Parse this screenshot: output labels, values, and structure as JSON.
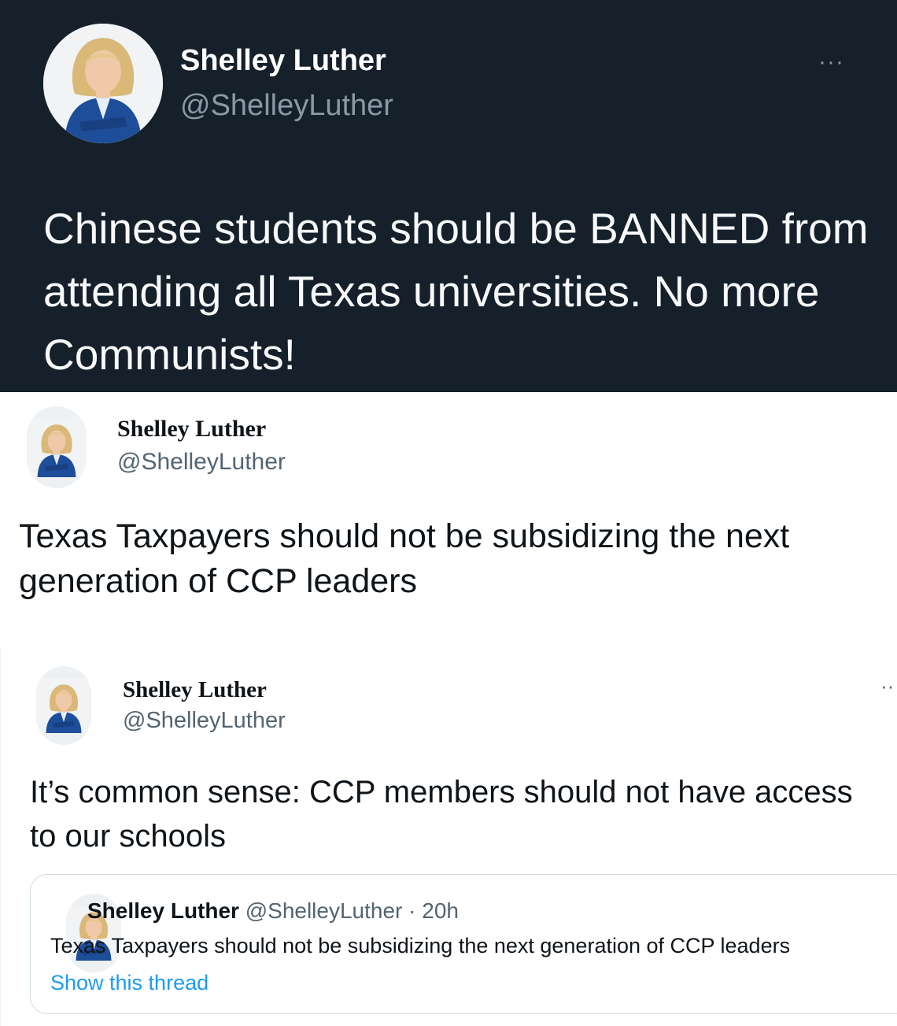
{
  "tweets": [
    {
      "name": "Shelley Luther",
      "handle": "@ShelleyLuther",
      "more": "···",
      "text": "Chinese students should be BANNED from attending all Texas universities. No more Communists!"
    },
    {
      "name": "Shelley Luther",
      "handle": "@ShelleyLuther",
      "text": "Texas Taxpayers should not be subsidizing the next generation of CCP leaders"
    },
    {
      "name": "Shelley Luther",
      "handle": "@ShelleyLuther",
      "more": "··",
      "text": "It’s common sense: CCP members should not have access to our schools",
      "quote": {
        "name": "Shelley Luther",
        "handle_time": "@ShelleyLuther · 20h",
        "text": "Texas Taxpayers should not be subsidizing the next generation of CCP leaders",
        "link": "Show this thread"
      }
    }
  ],
  "colors": {
    "dark_bg": "#15202b",
    "link": "#1d9bf0",
    "secondary_text": "#536471",
    "jacket": "#1e4e9a",
    "hair": "#d9b878"
  },
  "icons": [
    "avatar-photo",
    "more-options-icon"
  ]
}
